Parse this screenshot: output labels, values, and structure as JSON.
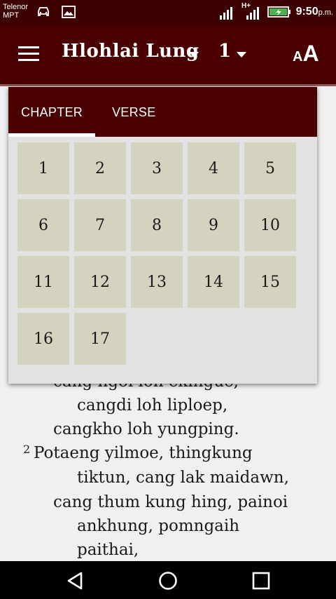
{
  "status_bar": {
    "carrier_line1": "Telenor",
    "carrier_line2": "MPT",
    "network": "H+",
    "time": "9:50",
    "ampm": "p.m.",
    "icons": [
      "car-icon",
      "image-icon",
      "signal-icon",
      "signal-icon",
      "battery-charging-icon"
    ]
  },
  "app_bar": {
    "book": "Hlohlai Lung",
    "chapter": "1",
    "font_button": {
      "small": "A",
      "large": "A"
    },
    "colors": {
      "bar": "#4a0000",
      "status": "#3d0000"
    }
  },
  "picker": {
    "tabs": [
      "CHAPTER",
      "VERSE"
    ],
    "active_tab": "CHAPTER",
    "chapters": [
      "1",
      "2",
      "3",
      "4",
      "5",
      "6",
      "7",
      "8",
      "9",
      "10",
      "11",
      "12",
      "13",
      "14",
      "15",
      "16",
      "17"
    ],
    "cell_color": "#d4d3bf"
  },
  "verses": {
    "partial_line": "cang ngoi loh ekingue,",
    "lines_before": [
      "cangdi loh liploep,",
      "cangkho loh yungping."
    ],
    "verse_2_number": "2",
    "verse_2_lines": [
      "Potaeng yilmoe, thingkung",
      "tiktun, cang lak maidawn,",
      "cang thum kung hing, painoi",
      "ankhung, pomngaih",
      "paithai,"
    ]
  },
  "nav_bar": {
    "icons": [
      "back-icon",
      "home-icon",
      "recents-icon"
    ]
  }
}
